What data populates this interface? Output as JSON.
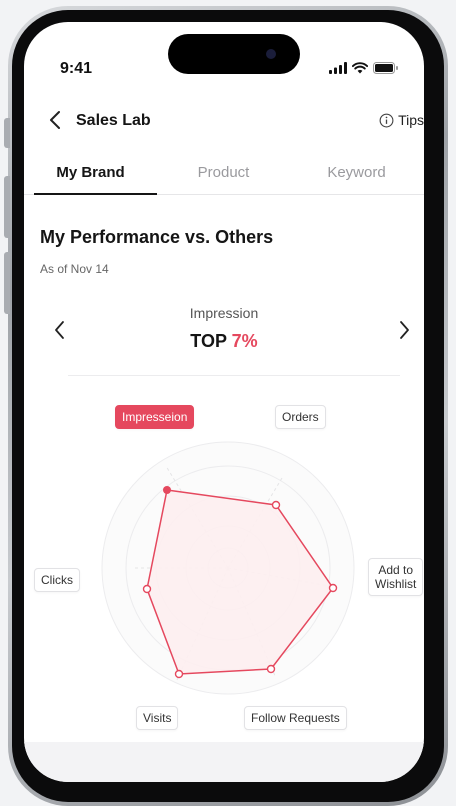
{
  "status": {
    "time": "9:41"
  },
  "header": {
    "title": "Sales Lab",
    "tips_label": "Tips"
  },
  "tabs": [
    {
      "label": "My Brand",
      "active": true
    },
    {
      "label": "Product",
      "active": false
    },
    {
      "label": "Keyword",
      "active": false
    }
  ],
  "performance": {
    "title": "My Performance vs. Others",
    "date": "As of Nov 14",
    "metric": "Impression",
    "rank_prefix": "TOP",
    "rank_value": "7%"
  },
  "radar": {
    "labels": {
      "impression": "Impresseion",
      "orders": "Orders",
      "wishlist_line1": "Add to",
      "wishlist_line2": "Wishlist",
      "follow": "Follow Requests",
      "visits": "Visits",
      "clicks": "Clicks"
    },
    "colors": {
      "accent": "#e5485e",
      "fill": "#fdeef0",
      "grid": "#ececee"
    }
  }
}
